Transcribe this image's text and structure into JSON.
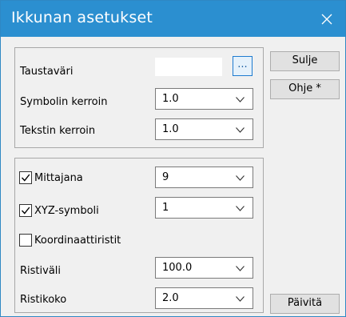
{
  "window": {
    "title": "Ikkunan asetukset"
  },
  "icons": {
    "close": "close-icon",
    "dropdown": "chevron-down-icon",
    "checkmark": "checkmark-icon"
  },
  "colors": {
    "titlebar": "#2b8fd0",
    "background": "#f0f0f0",
    "accent": "#1e7bd0"
  },
  "appearance": {
    "background_color_label": "Taustaväri",
    "background_color_value": "#ffffff",
    "browse_button_label": "...",
    "symbol_scale_label": "Symbolin kerroin",
    "symbol_scale_value": "1.0",
    "text_scale_label": "Tekstin kerroin",
    "text_scale_value": "1.0"
  },
  "measures": {
    "mittajana": {
      "label": "Mittajana",
      "checked": true,
      "value": "9"
    },
    "xyz_symbol": {
      "label": "XYZ-symboli",
      "checked": true,
      "value": "1"
    },
    "coordinate_crosses": {
      "label": "Koordinaattiristit",
      "checked": false
    },
    "cross_spacing_label": "Ristiväli",
    "cross_spacing_value": "100.0",
    "cross_size_label": "Ristikoko",
    "cross_size_value": "2.0"
  },
  "buttons": {
    "close_label": "Sulje",
    "help_label": "Ohje *",
    "refresh_label": "Päivitä"
  }
}
